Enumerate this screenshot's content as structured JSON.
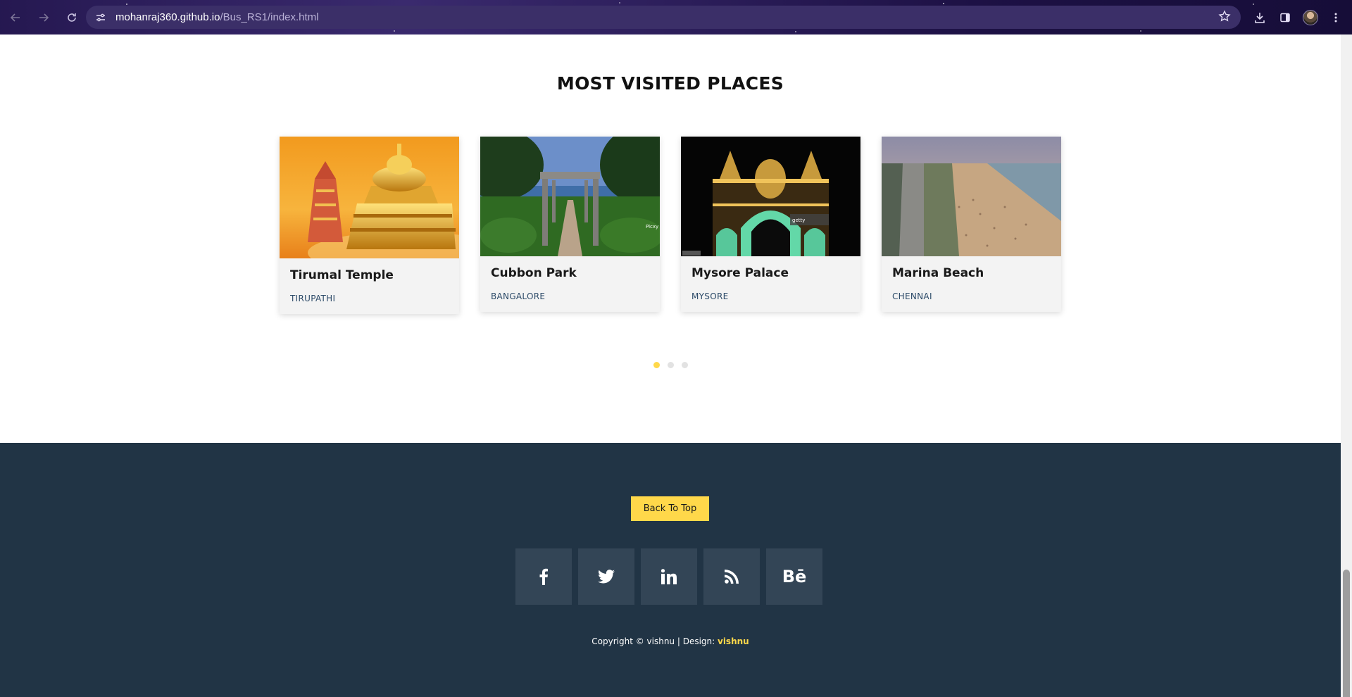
{
  "browser": {
    "url_host": "mohanraj360.github.io",
    "url_path": "/Bus_RS1/index.html",
    "icons": [
      "back-arrow-icon",
      "forward-arrow-icon",
      "reload-icon",
      "site-info-icon",
      "bookmark-star-icon",
      "download-icon",
      "side-panel-icon",
      "profile-avatar",
      "menu-icon"
    ]
  },
  "section": {
    "title": "MOST VISITED PLACES"
  },
  "places": [
    {
      "name": "Tirumal Temple",
      "location": "TIRUPATHI"
    },
    {
      "name": "Cubbon Park",
      "location": "BANGALORE"
    },
    {
      "name": "Mysore Palace",
      "location": "MYSORE"
    },
    {
      "name": "Marina Beach",
      "location": "CHENNAI"
    }
  ],
  "carousel": {
    "pages": 3,
    "active_page": 1
  },
  "footer": {
    "back_to_top": "Back To Top",
    "socials": [
      "facebook-icon",
      "twitter-icon",
      "linkedin-icon",
      "rss-icon",
      "behance-icon"
    ],
    "behance_glyph": "Bē",
    "copyright_text": "Copyright © vishnu | Design: ",
    "designer": "vishnu"
  },
  "colors": {
    "accent": "#ffd84a",
    "footer_bg": "#213445",
    "social_bg": "#334556",
    "location_text": "#2c4a68"
  }
}
